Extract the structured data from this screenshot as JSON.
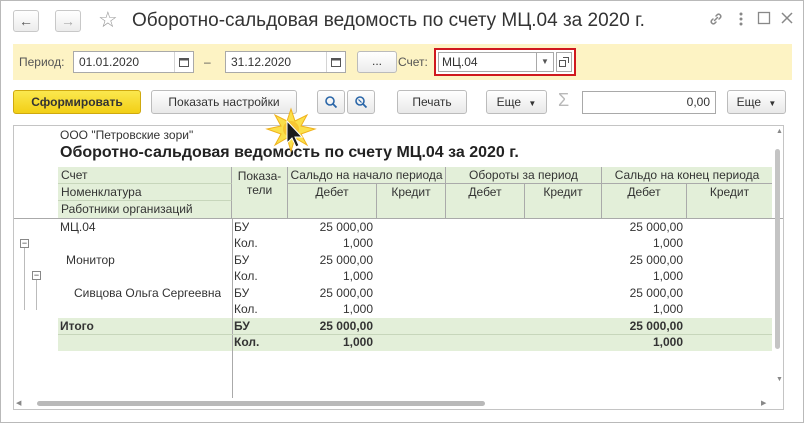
{
  "window": {
    "title": "Оборотно-сальдовая ведомость по счету МЦ.04 за 2020 г.",
    "nav": {
      "back": "←",
      "forward": "→"
    },
    "icons": {
      "star": "☆",
      "link": "🔗",
      "more": "⋮",
      "maximize": "□",
      "close": "×"
    }
  },
  "filter": {
    "period_label": "Период:",
    "date_from": "01.01.2020",
    "dash": "–",
    "date_to": "31.12.2020",
    "dots_label": "...",
    "account_label": "Счет:",
    "account_value": "МЦ.04"
  },
  "toolbar": {
    "generate_label": "Сформировать",
    "settings_label": "Показать настройки",
    "print_label": "Печать",
    "more_label": "Еще",
    "sigma": "Σ",
    "sum_value": "0,00",
    "more2_label": "Еще"
  },
  "report": {
    "org": "ООО \"Петровские зори\"",
    "title": "Оборотно-сальдовая ведомость по счету МЦ.04 за 2020 г.",
    "headers": {
      "account": "Счет",
      "nomenclature": "Номенклатура",
      "employees": "Работники организаций",
      "indicators": "Показа-\nтели",
      "opening": "Сальдо на начало периода",
      "turnover": "Обороты за период",
      "closing": "Сальдо на конец периода",
      "debit": "Дебет",
      "credit": "Кредит"
    },
    "rows": [
      {
        "name": "МЦ.04",
        "bu": "БУ",
        "qty": "Кол.",
        "open_debit_bu": "25 000,00",
        "open_debit_qty": "1,000",
        "close_debit_bu": "25 000,00",
        "close_debit_qty": "1,000"
      },
      {
        "name": "Монитор",
        "bu": "БУ",
        "qty": "Кол.",
        "open_debit_bu": "25 000,00",
        "open_debit_qty": "1,000",
        "close_debit_bu": "25 000,00",
        "close_debit_qty": "1,000"
      },
      {
        "name": "Сивцова Ольга Сергеевна",
        "bu": "БУ",
        "qty": "Кол.",
        "open_debit_bu": "25 000,00",
        "open_debit_qty": "1,000",
        "close_debit_bu": "25 000,00",
        "close_debit_qty": "1,000"
      }
    ],
    "total": {
      "name": "Итого",
      "bu": "БУ",
      "qty": "Кол.",
      "open_debit_bu": "25 000,00",
      "open_debit_qty": "1,000",
      "close_debit_bu": "25 000,00",
      "close_debit_qty": "1,000"
    },
    "tree_collapse": "−"
  },
  "colors": {
    "accent_yellow": "#f2cf16",
    "filter_bg": "#fdf3c4",
    "header_green": "#e3efd9",
    "highlight_red": "#d0181e"
  }
}
